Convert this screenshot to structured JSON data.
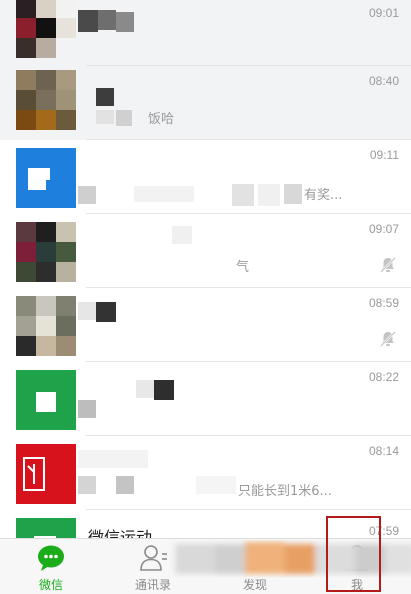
{
  "chats": [
    {
      "time": "09:01",
      "preview": "",
      "muted": false,
      "pinned": true
    },
    {
      "time": "08:40",
      "preview": "饭哈",
      "muted": false,
      "pinned": true
    },
    {
      "time": "09:11",
      "preview": "有奖...",
      "muted": false,
      "pinned": false
    },
    {
      "time": "09:07",
      "preview": "气",
      "muted": true,
      "pinned": false
    },
    {
      "time": "08:59",
      "preview": "",
      "muted": true,
      "pinned": false
    },
    {
      "time": "08:22",
      "preview": "",
      "muted": false,
      "pinned": false
    },
    {
      "time": "08:14",
      "preview": "只能长到1米6...",
      "muted": false,
      "pinned": false
    },
    {
      "time": "07:59",
      "name": "微信运动",
      "preview": "",
      "muted": false,
      "pinned": false
    }
  ],
  "tabs": [
    {
      "label": "微信",
      "icon": "chat-bubble-icon",
      "active": true
    },
    {
      "label": "通讯录",
      "icon": "contacts-icon",
      "active": false
    },
    {
      "label": "发现",
      "icon": "compass-icon",
      "active": false
    },
    {
      "label": "我",
      "icon": "person-icon",
      "active": false
    }
  ],
  "colors": {
    "accent": "#1aad19",
    "pinned_background": "#f1f3f5",
    "annotation_box": "#b31b1b"
  }
}
